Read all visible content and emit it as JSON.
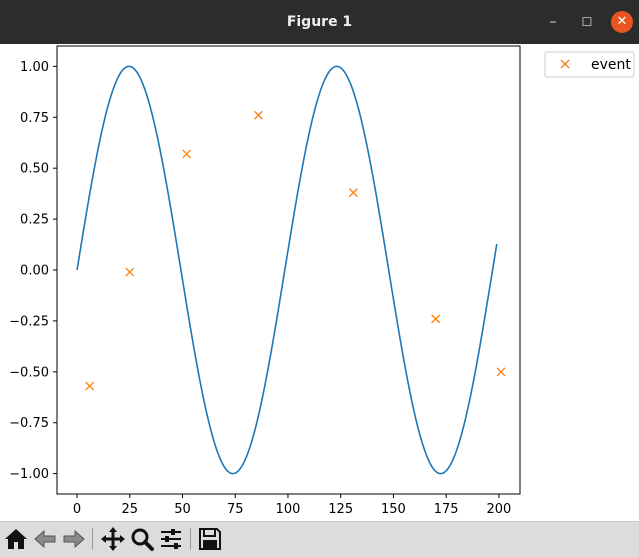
{
  "window": {
    "title": "Figure 1",
    "minimize_glyph": "–",
    "maximize_glyph": "☐",
    "close_glyph": "✕"
  },
  "toolbar": {
    "buttons": [
      {
        "icon": "home-icon"
      },
      {
        "icon": "back-arrow-icon"
      },
      {
        "icon": "forward-arrow-icon"
      },
      {
        "icon": "pan-icon"
      },
      {
        "icon": "zoom-icon"
      },
      {
        "icon": "configure-subplots-icon"
      },
      {
        "icon": "save-icon"
      }
    ],
    "coordinates": ""
  },
  "chart_data": {
    "type": "line",
    "title": "",
    "xlabel": "",
    "ylabel": "",
    "xlim": [
      -9.5,
      210
    ],
    "ylim": [
      -1.1,
      1.1
    ],
    "xticks": [
      0,
      25,
      50,
      75,
      100,
      125,
      150,
      175,
      200
    ],
    "xtick_labels": [
      "0",
      "25",
      "50",
      "75",
      "100",
      "125",
      "150",
      "175",
      "200"
    ],
    "yticks": [
      1.0,
      0.75,
      0.5,
      0.25,
      0.0,
      -0.25,
      -0.5,
      -0.75,
      -1.0
    ],
    "ytick_labels": [
      "1.00",
      "0.75",
      "0.50",
      "0.25",
      "0.00",
      "−0.25",
      "−0.50",
      "−0.75",
      "−1.00"
    ],
    "grid": false,
    "legend_position": "outside-upper-right",
    "series": [
      {
        "kind": "line",
        "function": "sin",
        "period": 98.5,
        "x_start": 0,
        "x_end": 199,
        "color": "#1f77b4"
      },
      {
        "kind": "scatter",
        "name": "event",
        "marker": "x",
        "color": "#ff7f0e",
        "points": [
          {
            "x": 6,
            "y": -0.57
          },
          {
            "x": 25,
            "y": -0.01
          },
          {
            "x": 52,
            "y": 0.57
          },
          {
            "x": 86,
            "y": 0.76
          },
          {
            "x": 131,
            "y": 0.38
          },
          {
            "x": 170,
            "y": -0.24
          },
          {
            "x": 201,
            "y": -0.5
          }
        ]
      }
    ]
  }
}
